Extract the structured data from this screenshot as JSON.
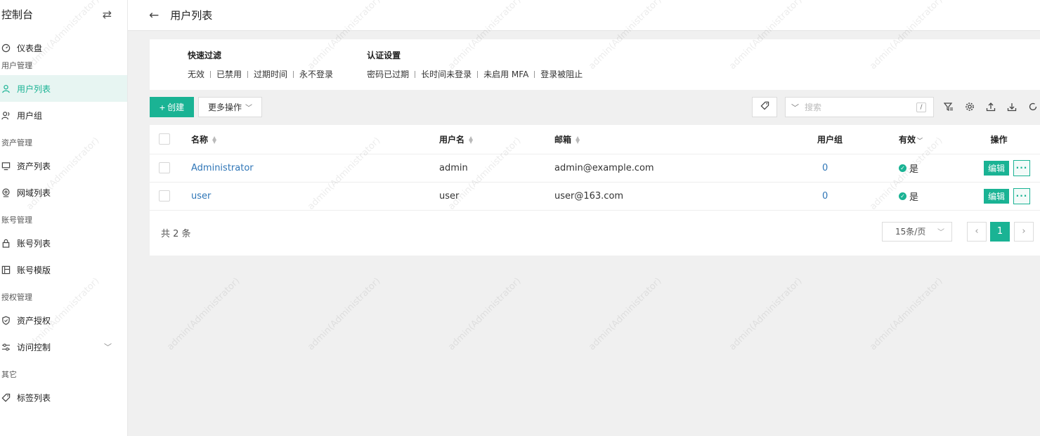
{
  "sidebar": {
    "title": "控制台",
    "items": {
      "dashboard": "仪表盘",
      "user_mgmt": "用户管理",
      "user_list": "用户列表",
      "user_group": "用户组",
      "asset_mgmt": "资产管理",
      "asset_list": "资产列表",
      "domain_list": "网域列表",
      "account_mgmt": "账号管理",
      "account_list": "账号列表",
      "account_template": "账号模版",
      "perm_mgmt": "授权管理",
      "asset_perm": "资产授权",
      "access_control": "访问控制",
      "other": "其它",
      "tag_list": "标签列表"
    }
  },
  "header": {
    "title": "用户列表"
  },
  "filters": {
    "quick": {
      "title": "快速过滤",
      "items": [
        "无效",
        "已禁用",
        "过期时间",
        "永不登录"
      ]
    },
    "auth": {
      "title": "认证设置",
      "items": [
        "密码已过期",
        "长时间未登录",
        "未启用 MFA",
        "登录被阻止"
      ]
    }
  },
  "toolbar": {
    "create": "创建",
    "more": "更多操作",
    "search_placeholder": "搜索",
    "slash": "/"
  },
  "table": {
    "columns": {
      "name": "名称",
      "username": "用户名",
      "email": "邮箱",
      "group": "用户组",
      "valid": "有效",
      "actions": "操作"
    },
    "rows": [
      {
        "name": "Administrator",
        "username": "admin",
        "email": "admin@example.com",
        "group": "0",
        "valid": "是"
      },
      {
        "name": "user",
        "username": "user",
        "email": "user@163.com",
        "group": "0",
        "valid": "是"
      }
    ],
    "edit_label": "编辑"
  },
  "pagination": {
    "total": "共 2 条",
    "page_size": "15条/页",
    "current": "1"
  },
  "watermark": "admin(Administrator)",
  "colors": {
    "accent": "#1ab394",
    "link": "#2f76b7"
  }
}
